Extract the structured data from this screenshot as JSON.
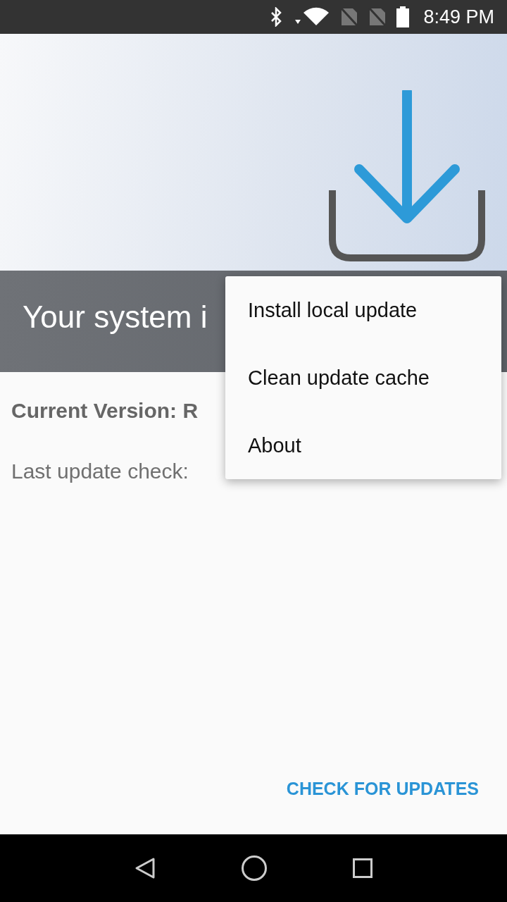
{
  "status_bar": {
    "time": "8:49 PM"
  },
  "banner": {
    "title": "Your system i"
  },
  "info": {
    "current_version": "Current Version: R",
    "last_check": "Last update check:"
  },
  "menu": {
    "items": [
      {
        "label": "Install local update"
      },
      {
        "label": "Clean update cache"
      },
      {
        "label": "About"
      }
    ]
  },
  "action": {
    "label": "CHECK FOR UPDATES"
  }
}
